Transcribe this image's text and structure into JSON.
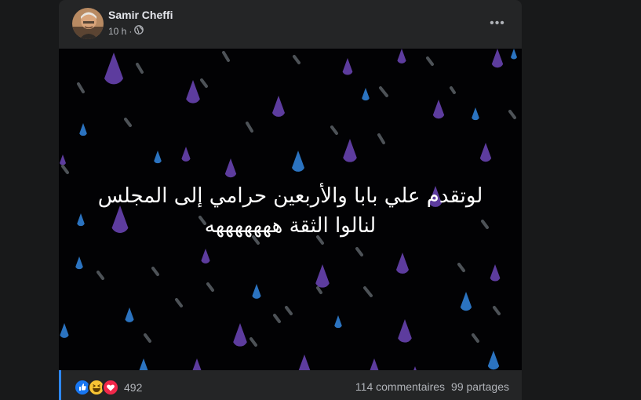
{
  "post": {
    "author": "Samir Cheffi",
    "time": "10 h",
    "separator": "·",
    "privacy_icon": "globe-icon",
    "more_icon": "more-options-icon",
    "text_lines": [
      "لوتقدم علي بابا والأربعين حرامي إلى المجلس",
      "لنالوا الثقة هههههههه"
    ],
    "background": "rain-drops",
    "colors": {
      "drop_purple": "#5d3c9e",
      "drop_blue": "#2b73c0",
      "streak_gray": "#4d5257",
      "link_bar": "#2d88ff"
    }
  },
  "footer": {
    "reactions": [
      "like",
      "haha",
      "love"
    ],
    "reaction_count": "492",
    "comments": "114 commentaires",
    "shares": "99 partages"
  }
}
